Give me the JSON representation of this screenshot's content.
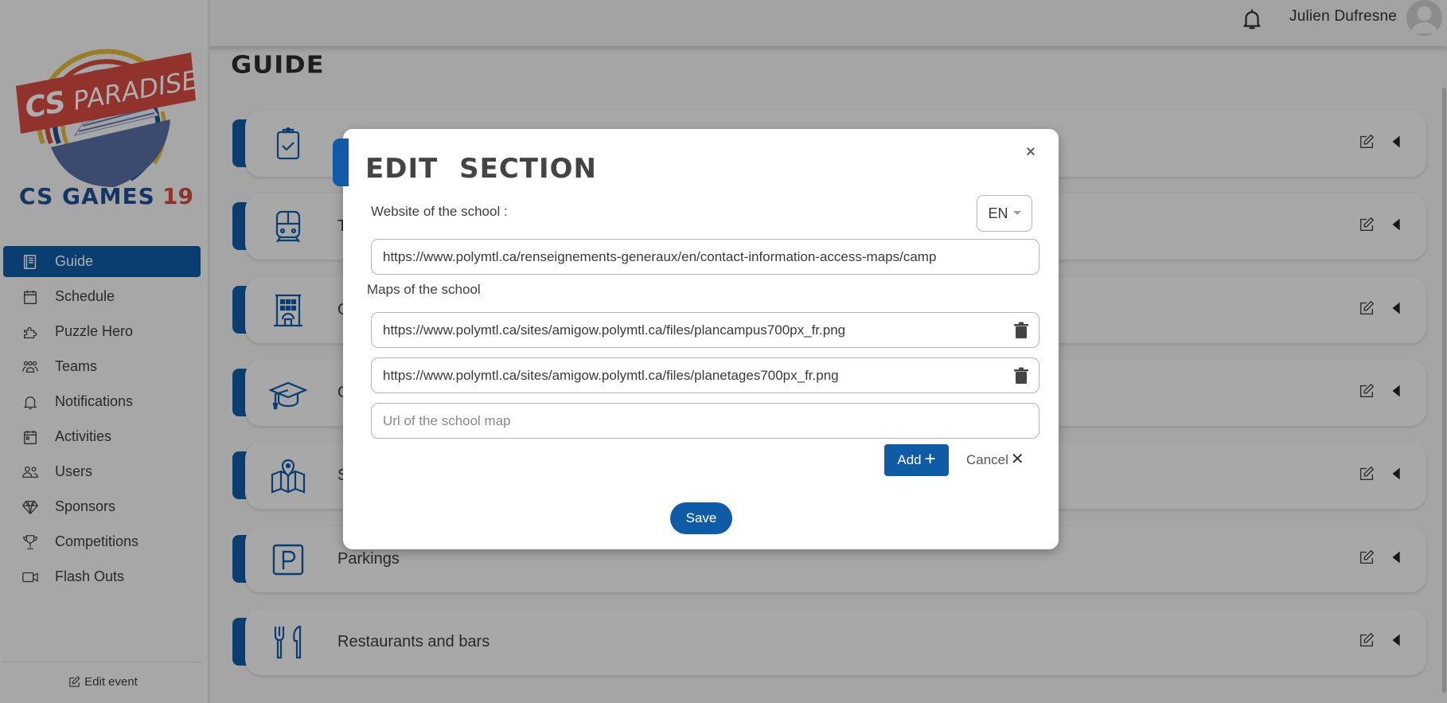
{
  "header": {
    "username": "Julien Dufresne"
  },
  "brand": {
    "logo_top_text": "CS PARADISE",
    "logo_bottom_text": "CS GAMES",
    "logo_year": "19"
  },
  "sidebar": {
    "items": [
      {
        "label": "Guide",
        "icon": "book-icon",
        "active": true
      },
      {
        "label": "Schedule",
        "icon": "calendar-icon",
        "active": false
      },
      {
        "label": "Puzzle Hero",
        "icon": "puzzle-icon",
        "active": false
      },
      {
        "label": "Teams",
        "icon": "team-icon",
        "active": false
      },
      {
        "label": "Notifications",
        "icon": "bell-icon",
        "active": false
      },
      {
        "label": "Activities",
        "icon": "calendar-event-icon",
        "active": false
      },
      {
        "label": "Users",
        "icon": "users-icon",
        "active": false
      },
      {
        "label": "Sponsors",
        "icon": "diamond-icon",
        "active": false
      },
      {
        "label": "Competitions",
        "icon": "trophy-icon",
        "active": false
      },
      {
        "label": "Flash Outs",
        "icon": "video-camera-icon",
        "active": false
      }
    ],
    "footer_label": "Edit event"
  },
  "page": {
    "title": "GUIDE",
    "cards": [
      {
        "label": "",
        "icon": "clipboard-check-icon"
      },
      {
        "label": "Tran",
        "icon": "train-icon"
      },
      {
        "label": "Ge",
        "icon": "building-icon"
      },
      {
        "label": "Ge",
        "icon": "graduation-cap-icon"
      },
      {
        "label": "Sc",
        "icon": "map-pin-icon"
      },
      {
        "label": "Parkings",
        "icon": "parking-icon"
      },
      {
        "label": "Restaurants and bars",
        "icon": "utensils-icon"
      }
    ]
  },
  "modal": {
    "title": "EDIT SECTION",
    "close_label": "×",
    "website_label": "Website of the school :",
    "language": "EN",
    "website_value": "https://www.polymtl.ca/renseignements-generaux/en/contact-information-access-maps/camp",
    "maps_label": "Maps of the school",
    "maps": [
      "https://www.polymtl.ca/sites/amigow.polymtl.ca/files/plancampus700px_fr.png",
      "https://www.polymtl.ca/sites/amigow.polymtl.ca/files/planetages700px_fr.png"
    ],
    "new_map_placeholder": "Url of the school map",
    "add_label": "Add",
    "add_symbol": "+",
    "cancel_label": "Cancel",
    "cancel_symbol": "✕",
    "save_label": "Save"
  },
  "colors": {
    "accent": "#0f5ba6",
    "text": "#3a3a3a"
  }
}
